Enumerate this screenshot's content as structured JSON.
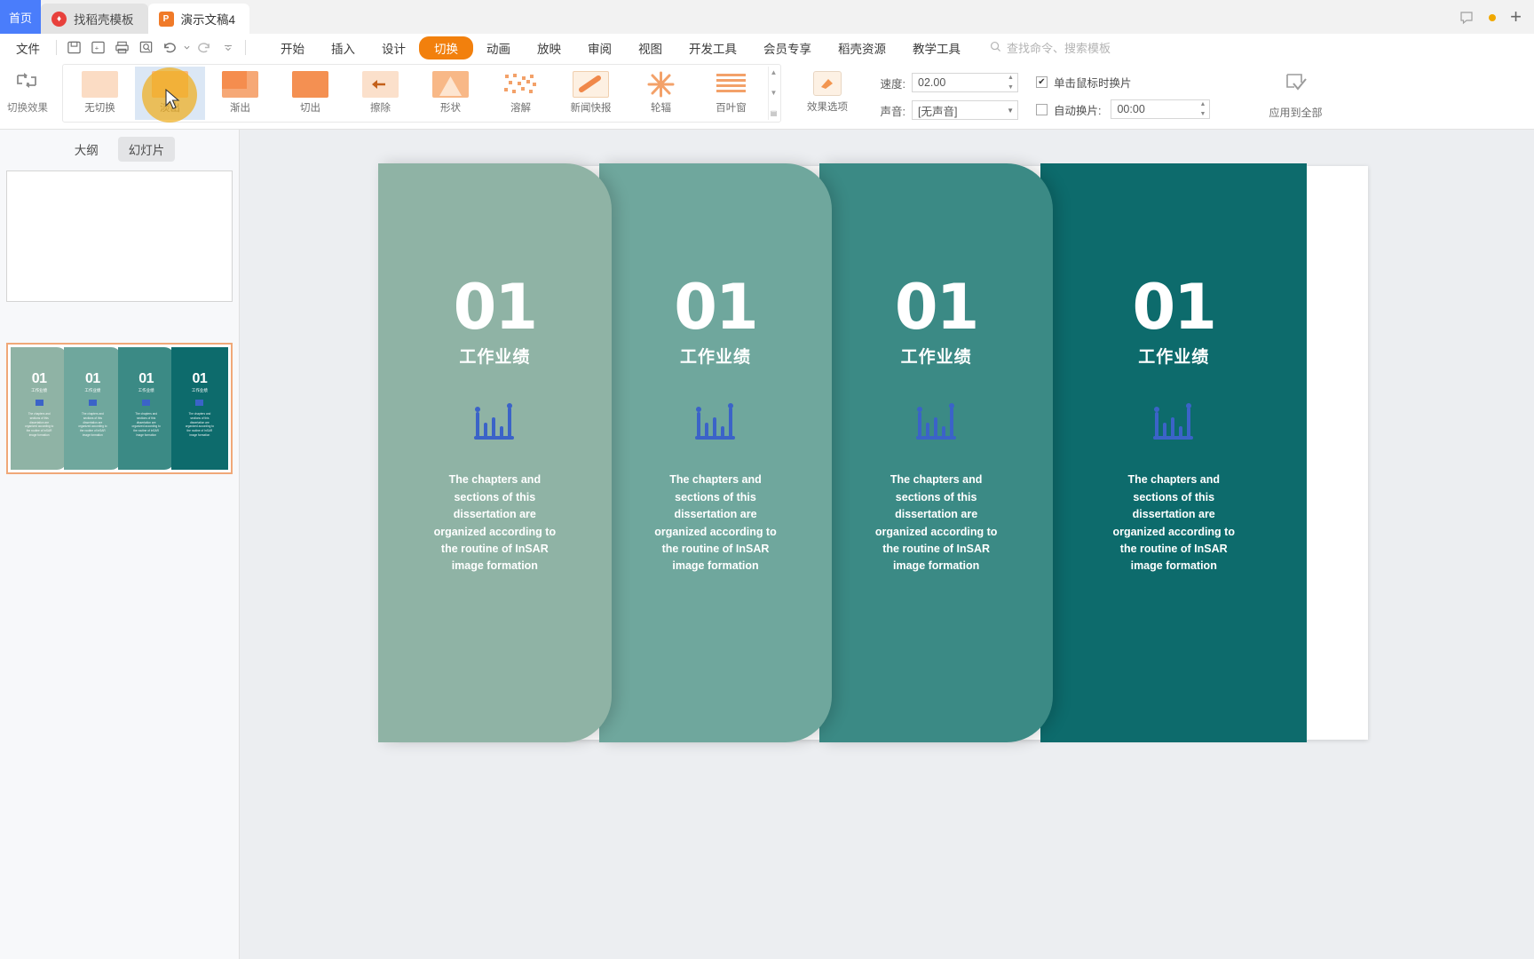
{
  "tabbar": {
    "home_tab": "首页",
    "tabs": [
      {
        "label": "找稻壳模板",
        "icon": "docer-icon",
        "active": false
      },
      {
        "label": "演示文稿4",
        "icon": "wps-presentation-icon",
        "active": true
      }
    ],
    "comment_icon": "comment-icon",
    "status_dot": "unsaved-dot",
    "new_tab": "+"
  },
  "menubar": {
    "file_label": "文件",
    "quick_access": [
      "save-icon",
      "save-as-icon",
      "print-icon",
      "print-preview-icon",
      "undo-icon",
      "redo-icon",
      "customize-icon"
    ],
    "items": [
      {
        "label": "开始",
        "selected": false
      },
      {
        "label": "插入",
        "selected": false
      },
      {
        "label": "设计",
        "selected": false
      },
      {
        "label": "切换",
        "selected": true
      },
      {
        "label": "动画",
        "selected": false
      },
      {
        "label": "放映",
        "selected": false
      },
      {
        "label": "审阅",
        "selected": false
      },
      {
        "label": "视图",
        "selected": false
      },
      {
        "label": "开发工具",
        "selected": false
      },
      {
        "label": "会员专享",
        "selected": false
      },
      {
        "label": "稻壳资源",
        "selected": false
      },
      {
        "label": "教学工具",
        "selected": false
      }
    ],
    "search_placeholder": "查找命令、搜索模板",
    "accent_color": "#f2800d"
  },
  "ribbon": {
    "effect_group_label": "切换效果",
    "gallery": [
      {
        "label": "无切换",
        "hovered": false
      },
      {
        "label": "淡出",
        "hovered": true
      },
      {
        "label": "渐出",
        "hovered": false
      },
      {
        "label": "切出",
        "hovered": false
      },
      {
        "label": "擦除",
        "hovered": false
      },
      {
        "label": "形状",
        "hovered": false
      },
      {
        "label": "溶解",
        "hovered": false
      },
      {
        "label": "新闻快报",
        "hovered": false
      },
      {
        "label": "轮辐",
        "hovered": false
      },
      {
        "label": "百叶窗",
        "hovered": false
      }
    ],
    "effect_options_label": "效果选项",
    "speed_label": "速度:",
    "speed_value": "02.00",
    "sound_label": "声音:",
    "sound_value": "[无声音]",
    "click_advance_label": "单击鼠标时换片",
    "click_advance_checked": true,
    "auto_advance_label": "自动换片:",
    "auto_advance_checked": false,
    "auto_advance_value": "00:00",
    "apply_all_label": "应用到全部"
  },
  "leftpanel": {
    "tabs": [
      {
        "label": "大纲",
        "selected": false
      },
      {
        "label": "幻灯片",
        "selected": true
      }
    ],
    "slides": [
      {
        "index": 1,
        "selected": false,
        "blank": true
      },
      {
        "index": 2,
        "selected": true,
        "blank": false
      }
    ]
  },
  "slide": {
    "cards": [
      {
        "number": "01",
        "subtitle": "工作业绩",
        "icon": "bar-chart-icon",
        "body": "The chapters and sections of this dissertation are organized according to the routine of InSAR image formation",
        "color": "#8fb3a5"
      },
      {
        "number": "01",
        "subtitle": "工作业绩",
        "icon": "bar-chart-icon",
        "body": "The chapters and sections of this dissertation are organized according to the routine of InSAR image formation",
        "color": "#6fa79d"
      },
      {
        "number": "01",
        "subtitle": "工作业绩",
        "icon": "bar-chart-icon",
        "body": "The chapters and sections of this dissertation are organized according to the routine of InSAR image formation",
        "color": "#3b8a85"
      },
      {
        "number": "01",
        "subtitle": "工作业绩",
        "icon": "bar-chart-icon",
        "body": "The chapters and sections of this dissertation are organized according to the routine of InSAR image formation",
        "color": "#0d6b6c"
      }
    ],
    "icon_color": "#3b63c8"
  }
}
